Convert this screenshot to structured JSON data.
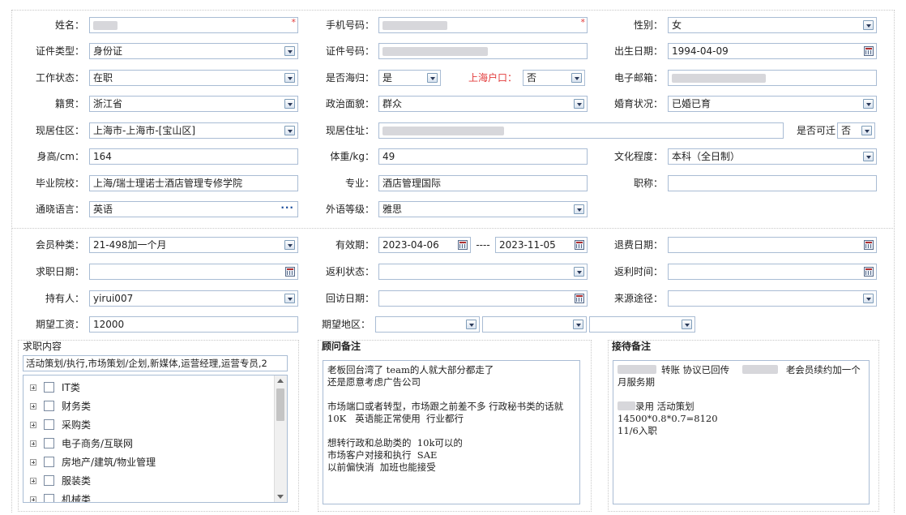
{
  "personal": {
    "name_label": "姓名：",
    "mobile_label": "手机号码：",
    "gender_label": "性别：",
    "gender_value": "女",
    "id_type_label": "证件类型：",
    "id_type_value": "身份证",
    "id_number_label": "证件号码：",
    "birthdate_label": "出生日期：",
    "birthdate_value": "1994-04-09",
    "work_status_label": "工作状态：",
    "work_status_value": "在职",
    "returnee_label": "是否海归：",
    "returnee_value": "是",
    "shanghai_hukou_label": "上海户口：",
    "shanghai_hukou_value": "否",
    "email_label": "电子邮箱：",
    "native_place_label": "籍贯：",
    "native_place_value": "浙江省",
    "political_label": "政治面貌：",
    "political_value": "群众",
    "marital_label": "婚育状况：",
    "marital_value": "已婚已育",
    "residence_area_label": "现居住区：",
    "residence_area_value": "上海市-上海市-[宝山区]",
    "residence_address_label": "现居住址：",
    "relocatable_label": "是否可迁",
    "relocatable_value": "否",
    "height_label": "身高/cm：",
    "height_value": "164",
    "weight_label": "体重/kg：",
    "weight_value": "49",
    "education_label": "文化程度：",
    "education_value": "本科（全日制）",
    "school_label": "毕业院校：",
    "school_value": "上海/瑞士理诺士酒店管理专修学院",
    "major_label": "专业：",
    "major_value": "酒店管理国际",
    "title_label": "职称：",
    "language_label": "通晓语言：",
    "language_value": "英语",
    "foreign_level_label": "外语等级：",
    "foreign_level_value": "雅思"
  },
  "membership": {
    "member_type_label": "会员种类：",
    "member_type_value": "21-498加一个月",
    "valid_label": "有效期：",
    "valid_from": "2023-04-06",
    "valid_sep": "----",
    "valid_to": "2023-11-05",
    "refund_date_label": "退费日期：",
    "job_date_label": "求职日期：",
    "rebate_status_label": "返利状态：",
    "rebate_time_label": "返利时间：",
    "holder_label": "持有人：",
    "holder_value": "yirui007",
    "revisit_label": "回访日期：",
    "source_label": "来源途径：",
    "salary_label": "期望工资：",
    "salary_value": "12000",
    "region_label": "期望地区："
  },
  "job_content": {
    "title": "求职内容",
    "selected_text": "活动策划/执行,市场策划/企划,新媒体,运营经理,运营专员,2",
    "tree_items": [
      "IT类",
      "财务类",
      "采购类",
      "电子商务/互联网",
      "房地产/建筑/物业管理",
      "服装类",
      "机械类"
    ]
  },
  "consultant_notes": {
    "title": "顾问备注",
    "text": "老板回台湾了 team的人就大部分都走了\n还是愿意考虑广告公司\n\n市场端口或者转型，市场跟之前差不多 行政秘书类的话就10K   英语能正常使用  行业都行\n\n想转行政和总助类的  10k可以的\n市场客户对接和执行  SAE\n以前偏快消  加班也能接受"
  },
  "reception_notes": {
    "title": "接待备注",
    "line1_a": "转账 协议已回传",
    "line1_b": "老会员续约加一个月服务期",
    "line2": "录用 活动策划",
    "line3": "14500*0.8*0.7=8120",
    "line4": "11/6入职"
  },
  "colors": {
    "border": "#a9bcd4",
    "required": "#e23a3a",
    "label_red": "#e23a3a"
  }
}
